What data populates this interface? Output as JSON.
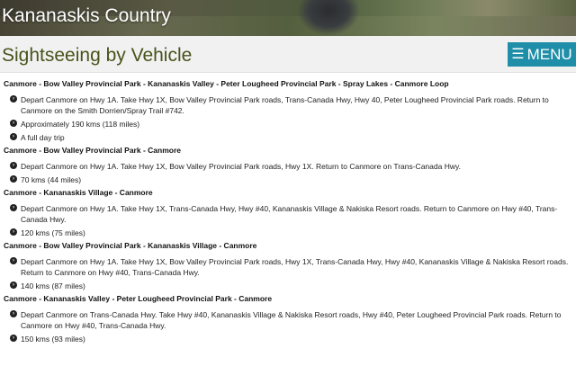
{
  "site_title": "Kananaskis Country",
  "page_title": "Sightseeing by Vehicle",
  "menu_label": "MENU",
  "routes": [
    {
      "title": "Canmore - Bow Valley Provincial Park - Kananaskis Valley - Peter Lougheed Provincial Park - Spray Lakes - Canmore  Loop",
      "items": [
        "Depart Canmore on Hwy 1A.  Take Hwy 1X, Bow Valley Provincial Park roads, Trans-Canada Hwy, Hwy 40, Peter Lougheed Provincial Park roads.  Return to Canmore on the Smith Dorrien/Spray Trail #742.",
        "Approximately 190 kms (118 miles)",
        "A full day trip"
      ]
    },
    {
      "title": "Canmore - Bow Valley Provincial Park - Canmore",
      "items": [
        "Depart Canmore on Hwy 1A.  Take Hwy 1X, Bow Valley Provincial Park roads, Hwy 1X.  Return to Canmore on Trans-Canada Hwy.",
        "70 kms (44 miles)"
      ]
    },
    {
      "title": "Canmore - Kananaskis Village - Canmore",
      "items": [
        "Depart Canmore on Hwy 1A.  Take Hwy 1X, Trans-Canada Hwy, Hwy #40, Kananaskis Village & Nakiska Resort roads.  Return to Canmore on Hwy #40, Trans-Canada Hwy.",
        "120 kms (75 miles)"
      ]
    },
    {
      "title": "Canmore - Bow Valley Provincial Park - Kananaskis Village - Canmore",
      "items": [
        "Depart Canmore on Hwy 1A.  Take Hwy 1X, Bow Valley Provincial Park roads, Hwy 1X, Trans-Canada Hwy, Hwy #40, Kananaskis Village & Nakiska Resort roads.  Return to Canmore on Hwy #40, Trans-Canada Hwy.",
        "140 kms (87 miles)"
      ]
    },
    {
      "title": "Canmore - Kananaskis Valley - Peter Lougheed Provincial Park - Canmore",
      "items": [
        "Depart Canmore on Trans-Canada Hwy.  Take Hwy #40, Kananaskis Village & Nakiska Resort roads, Hwy #40, Peter Lougheed Provincial Park roads.  Return to Canmore on Hwy #40, Trans-Canada Hwy.",
        "150 kms (93 miles)"
      ]
    }
  ]
}
